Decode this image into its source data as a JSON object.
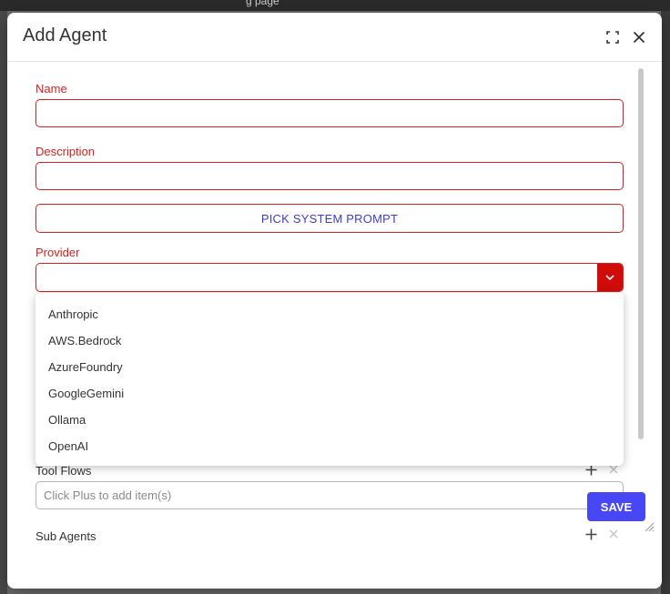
{
  "backdrop": {
    "top_text": "g  page"
  },
  "dialog": {
    "title": "Add Agent",
    "icons": {
      "maximize": "maximize-icon",
      "close": "close-icon"
    }
  },
  "form": {
    "name": {
      "label": "Name",
      "value": "",
      "placeholder": ""
    },
    "description": {
      "label": "Description",
      "value": "",
      "placeholder": ""
    },
    "pick_system_prompt_label": "PICK SYSTEM PROMPT",
    "provider": {
      "label": "Provider",
      "selected": "",
      "options": [
        "Anthropic",
        "AWS.Bedrock",
        "AzureFoundry",
        "GoogleGemini",
        "Ollama",
        "OpenAI"
      ]
    },
    "tool_flows": {
      "label": "Tool Flows",
      "placeholder": "Click Plus to add item(s)"
    },
    "sub_agents": {
      "label": "Sub Agents"
    }
  },
  "actions": {
    "save_label": "SAVE"
  },
  "colors": {
    "error_red": "#d61f1f",
    "link_blue": "#3d3dcc",
    "primary": "#4747f5",
    "dropdown_arrow_bg": "#d10a0a"
  }
}
